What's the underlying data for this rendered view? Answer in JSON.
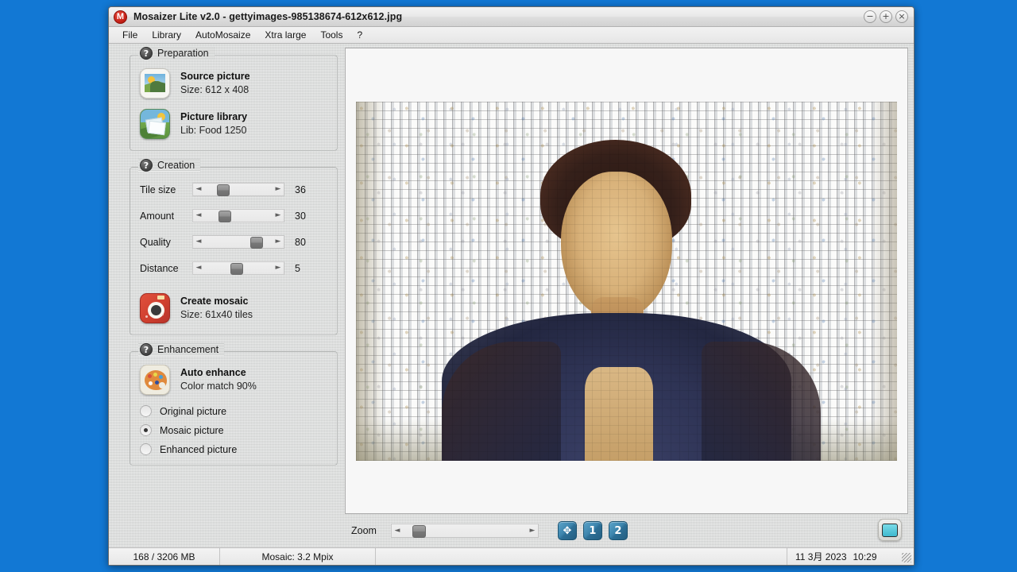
{
  "window": {
    "title": "Mosaizer Lite v2.0 - gettyimages-985138674-612x612.jpg",
    "app_icon": "mosaizer-logo-icon",
    "minimize": "−",
    "maximize": "+",
    "close": "×"
  },
  "menu": {
    "items": [
      {
        "label": "File"
      },
      {
        "label": "Library"
      },
      {
        "label": "AutoMosaize"
      },
      {
        "label": "Xtra large"
      },
      {
        "label": "Tools"
      },
      {
        "label": "?"
      }
    ]
  },
  "preparation": {
    "group_label": "Preparation",
    "help": "?",
    "source": {
      "title": "Source picture",
      "detail": "Size: 612 x 408"
    },
    "library": {
      "title": "Picture library",
      "detail": "Lib: Food 1250"
    }
  },
  "creation": {
    "group_label": "Creation",
    "help": "?",
    "sliders": [
      {
        "label": "Tile size",
        "value": "36",
        "percent": 28
      },
      {
        "label": "Amount",
        "value": "30",
        "percent": 30
      },
      {
        "label": "Quality",
        "value": "80",
        "percent": 66
      },
      {
        "label": "Distance",
        "value": "5",
        "percent": 43
      }
    ],
    "arrow_left": "◄",
    "arrow_right": "►",
    "create": {
      "title": "Create mosaic",
      "detail": "Size: 61x40 tiles"
    }
  },
  "enhancement": {
    "group_label": "Enhancement",
    "help": "?",
    "auto": {
      "title": "Auto enhance",
      "detail": "Color match 90%"
    },
    "radios": [
      {
        "label": "Original picture",
        "selected": false
      },
      {
        "label": "Mosaic picture",
        "selected": true
      },
      {
        "label": "Enhanced picture",
        "selected": false
      }
    ]
  },
  "zoombar": {
    "label": "Zoom",
    "arrow_left": "◄",
    "arrow_right": "►",
    "percent": 14,
    "buttons": [
      {
        "name": "fit-to-window",
        "label": "✥"
      },
      {
        "name": "zoom-1",
        "label": "1"
      },
      {
        "name": "zoom-2",
        "label": "2"
      }
    ],
    "display_button": "monitor-icon"
  },
  "statusbar": {
    "memory": "168 / 3206 MB",
    "mosaic": "Mosaic: 3.2 Mpix",
    "spare": "",
    "date": "11 3月 2023",
    "time": "10:29"
  },
  "colors": {
    "desktop": "#1278d4",
    "panel": "#d5d7d6",
    "accent_blue": "#2d6f96",
    "accent_red": "#c11d14"
  }
}
